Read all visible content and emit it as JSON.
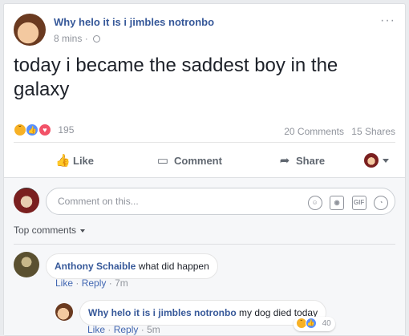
{
  "post": {
    "author": "Why helo it is i jimbles notronbo",
    "time": "8 mins",
    "text": "today i became the saddest boy in the galaxy",
    "more": "···"
  },
  "stats": {
    "reaction_count": "195",
    "comments": "20 Comments",
    "shares": "15 Shares"
  },
  "actions": {
    "like": "Like",
    "comment": "Comment",
    "share": "Share"
  },
  "composer": {
    "placeholder": "Comment on this..."
  },
  "sort": {
    "label": "Top comments"
  },
  "comments": [
    {
      "author": "Anthony Schaible",
      "text": "what did happen",
      "like": "Like",
      "reply": "Reply",
      "time": "7m"
    },
    {
      "author": "Why helo it is i jimbles notronbo",
      "text": "my dog died today",
      "like": "Like",
      "reply": "Reply",
      "time": "5m",
      "reactions": "40"
    }
  ],
  "colors": {
    "link": "#365899",
    "meta": "#90949c",
    "like_blue": "#5890ff",
    "love_red": "#f25268",
    "sad_yellow": "#f7b125"
  }
}
